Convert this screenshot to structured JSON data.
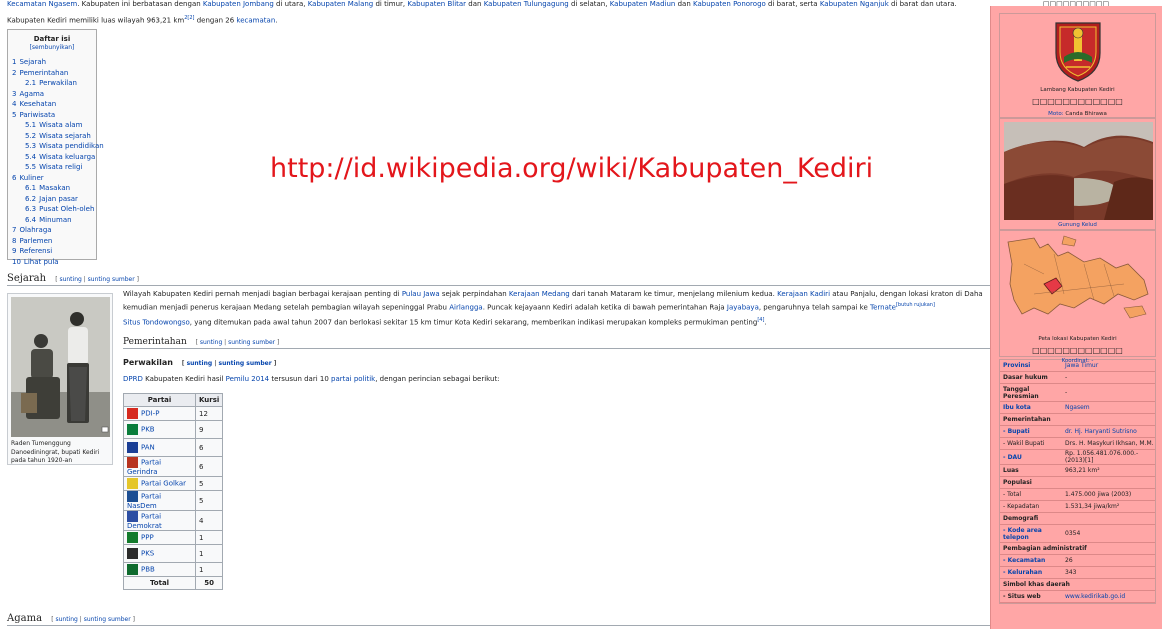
{
  "intro": {
    "line1_parts": [
      {
        "t": "Kecamatan Ngasem",
        "link": true
      },
      {
        "t": ". Kabupaten ini berbatasan dengan ",
        "link": false
      },
      {
        "t": "Kabupaten Jombang",
        "link": true
      },
      {
        "t": " di utara, ",
        "link": false
      },
      {
        "t": "Kabupaten Malang",
        "link": true
      },
      {
        "t": " di timur, ",
        "link": false
      },
      {
        "t": "Kabupaten Blitar",
        "link": true
      },
      {
        "t": " dan ",
        "link": false
      },
      {
        "t": "Kabupaten Tulungagung",
        "link": true
      },
      {
        "t": " di selatan, ",
        "link": false
      },
      {
        "t": "Kabupaten Madiun",
        "link": true
      },
      {
        "t": " dan ",
        "link": false
      },
      {
        "t": "Kabupaten Ponorogo",
        "link": true
      },
      {
        "t": " di barat, serta ",
        "link": false
      },
      {
        "t": "Kabupaten Nganjuk",
        "link": true
      },
      {
        "t": " di barat dan utara.",
        "link": false
      }
    ],
    "line2_a": "Kabupaten Kediri memiliki luas wilayah 963,21 km",
    "line2_sup": "2[2]",
    "line2_b": " dengan 26 ",
    "line2_link": "kecamatan",
    "line2_c": "."
  },
  "toc": {
    "title": "Daftar isi",
    "hide": "[sembunyikan]",
    "items": [
      {
        "num": "1",
        "label": "Sejarah",
        "sub": false
      },
      {
        "num": "2",
        "label": "Pemerintahan",
        "sub": false
      },
      {
        "num": "2.1",
        "label": "Perwakilan",
        "sub": true
      },
      {
        "num": "3",
        "label": "Agama",
        "sub": false
      },
      {
        "num": "4",
        "label": "Kesehatan",
        "sub": false
      },
      {
        "num": "5",
        "label": "Pariwisata",
        "sub": false
      },
      {
        "num": "5.1",
        "label": "Wisata alam",
        "sub": true
      },
      {
        "num": "5.2",
        "label": "Wisata sejarah",
        "sub": true
      },
      {
        "num": "5.3",
        "label": "Wisata pendidikan",
        "sub": true
      },
      {
        "num": "5.4",
        "label": "Wisata keluarga",
        "sub": true
      },
      {
        "num": "5.5",
        "label": "Wisata religi",
        "sub": true
      },
      {
        "num": "6",
        "label": "Kuliner",
        "sub": false
      },
      {
        "num": "6.1",
        "label": "Masakan",
        "sub": true
      },
      {
        "num": "6.2",
        "label": "Jajan pasar",
        "sub": true
      },
      {
        "num": "6.3",
        "label": "Pusat Oleh-oleh",
        "sub": true
      },
      {
        "num": "6.4",
        "label": "Minuman",
        "sub": true
      },
      {
        "num": "7",
        "label": "Olahraga",
        "sub": false
      },
      {
        "num": "8",
        "label": "Parlemen",
        "sub": false
      },
      {
        "num": "9",
        "label": "Referensi",
        "sub": false
      },
      {
        "num": "10",
        "label": "Lihat pula",
        "sub": false
      }
    ]
  },
  "watermark": "http://id.wikipedia.org/wiki/Kabupaten_Kediri",
  "edit_links": {
    "open": "[ ",
    "edit": "sunting",
    "sep": " | ",
    "edit_source": "sunting sumber",
    "close": " ]"
  },
  "sections": {
    "sejarah": "Sejarah",
    "pemerintahan": "Pemerintahan",
    "perwakilan": "Perwakilan",
    "agama": "Agama"
  },
  "thumb_caption": "Raden Tumenggung Danoediningrat, bupati Kediri pada tahun 1920-an",
  "sejarah_p1": [
    {
      "t": "Wilayah Kabupaten Kediri pernah menjadi bagian berbagai kerajaan penting di ",
      "link": false
    },
    {
      "t": "Pulau Jawa",
      "link": true
    },
    {
      "t": " sejak perpindahan ",
      "link": false
    },
    {
      "t": "Kerajaan Medang",
      "link": true
    },
    {
      "t": " dari tanah Mataram ke timur, menjelang milenium kedua. ",
      "link": false
    },
    {
      "t": "Kerajaan Kadiri",
      "link": true
    },
    {
      "t": " atau Panjalu, dengan lokasi kraton di Daha kemudian menjadi penerus kerajaan Medang setelah pembagian wilayah sepeninggal Prabu ",
      "link": false
    },
    {
      "t": "Airlangga",
      "link": true
    },
    {
      "t": ". Puncak kejayaann Kediri adalah ketika di bawah pemerintahan Raja ",
      "link": false
    },
    {
      "t": "Jayabaya",
      "link": true
    },
    {
      "t": ", pengaruhnya telah sampai ke ",
      "link": false
    },
    {
      "t": "Ternate",
      "link": true
    },
    {
      "t": "[butuh rujukan]",
      "link": true,
      "sup": true
    }
  ],
  "sejarah_p2": [
    {
      "t": "Situs Tondowongso",
      "link": true
    },
    {
      "t": ", yang ditemukan pada awal tahun 2007 dan berlokasi sekitar 15 km timur Kota Kediri sekarang, memberikan indikasi merupakan kompleks permukiman penting",
      "link": false
    },
    {
      "t": "[4]",
      "link": true,
      "sup": true
    },
    {
      "t": ".",
      "link": false
    }
  ],
  "perwakilan_p": [
    {
      "t": "DPRD",
      "link": true
    },
    {
      "t": " Kabupaten Kediri hasil ",
      "link": false
    },
    {
      "t": "Pemilu 2014",
      "link": true
    },
    {
      "t": " tersusun dari 10 ",
      "link": false
    },
    {
      "t": "partai politik",
      "link": true
    },
    {
      "t": ", dengan perincian sebagai berikut:",
      "link": false
    }
  ],
  "party_table": {
    "headers": [
      "Partai",
      "Kursi"
    ],
    "rows": [
      {
        "name": "PDI-P",
        "seats": "12",
        "color": "#d62a1f",
        "short": true
      },
      {
        "name": "PKB",
        "seats": "9",
        "color": "#0a7d3b",
        "short": false
      },
      {
        "name": "PAN",
        "seats": "6",
        "color": "#1b3f95",
        "short": false
      },
      {
        "name": "Partai Gerindra",
        "seats": "6",
        "color": "#b8331e",
        "short": true
      },
      {
        "name": "Partai Golkar",
        "seats": "5",
        "color": "#e5c62a",
        "short": true
      },
      {
        "name": "Partai NasDem",
        "seats": "5",
        "color": "#1c4e93",
        "short": false
      },
      {
        "name": "Partai Demokrat",
        "seats": "4",
        "color": "#2c4ea3",
        "short": true
      },
      {
        "name": "PPP",
        "seats": "1",
        "color": "#127a2b",
        "short": true
      },
      {
        "name": "PKS",
        "seats": "1",
        "color": "#2b2b2b",
        "short": false
      },
      {
        "name": "PBB",
        "seats": "1",
        "color": "#0f6b2e",
        "short": true
      }
    ],
    "total_label": "Total",
    "total_value": "50"
  },
  "infobox": {
    "top_caption": "□□□□□□□□□□",
    "emblem_caption": "Lambang Kabupaten Kediri",
    "emblem_script": "□□□□□□□□□□□□",
    "motto_label": "Moto:",
    "motto_value": "Canda Bhirawa",
    "photo_caption": "Gunung Kelud",
    "map_caption": "Peta lokasi Kabupaten Kediri",
    "map_script": "□□□□□□□□□□□□",
    "coords": "Koordinat: -",
    "rows": [
      {
        "k": "Provinsi",
        "v": "Jawa Timur",
        "klink": true,
        "vlink": true
      },
      {
        "k": "Dasar hukum",
        "v": "-"
      },
      {
        "k": "Tanggal Peresmian",
        "v": "-"
      },
      {
        "k": "Ibu kota",
        "v": "Ngasem",
        "klink": true,
        "vlink": true
      },
      {
        "k": "Pemerintahan",
        "v": "",
        "head": true
      },
      {
        "k": "- Bupati",
        "v": "dr. Hj. Haryanti Sutrisno",
        "klink": true,
        "vlink": true
      },
      {
        "k": "- Wakil Bupati",
        "v": "Drs. H. Masykuri Ikhsan, M.M.",
        "normal": true
      },
      {
        "k": "- DAU",
        "v": "Rp. 1.056.481.076.000.- (2013)[1]",
        "klink": true
      },
      {
        "k": "Luas",
        "v": "963,21 km²"
      },
      {
        "k": "Populasi",
        "v": "",
        "head": true
      },
      {
        "k": "- Total",
        "v": "1.475.000 jiwa (2003)",
        "normal": true
      },
      {
        "k": "- Kepadatan",
        "v": "1.531,34 jiwa/km²",
        "normal": true
      },
      {
        "k": "Demografi",
        "v": "",
        "head": true
      },
      {
        "k": "- Kode area telepon",
        "v": "0354",
        "klink": true
      },
      {
        "k": "Pembagian administratif",
        "v": "",
        "head": true
      },
      {
        "k": "- Kecamatan",
        "v": "26",
        "klink": true
      },
      {
        "k": "- Kelurahan",
        "v": "343",
        "klink": true
      },
      {
        "k": "Simbol khas daerah",
        "v": "",
        "head": true
      },
      {
        "k": "- Situs web",
        "v": "www.kedirikab.go.id",
        "vlink": true
      }
    ]
  }
}
